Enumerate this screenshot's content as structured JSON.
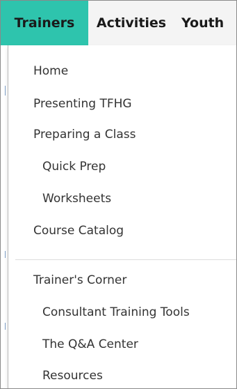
{
  "nav": {
    "tabs": [
      {
        "label": "Trainers",
        "active": true
      },
      {
        "label": "Activities",
        "active": false
      },
      {
        "label": "Youth",
        "active": false
      }
    ]
  },
  "dropdown": {
    "section_1": [
      {
        "label": "Home"
      },
      {
        "label": "Presenting TFHG"
      },
      {
        "label": "Preparing a Class"
      },
      {
        "label": "Quick Prep"
      },
      {
        "label": "Worksheets"
      },
      {
        "label": "Course Catalog"
      }
    ],
    "section_2": [
      {
        "label": "Trainer's Corner"
      },
      {
        "label": "Consultant Training Tools"
      },
      {
        "label": "The Q&A Center"
      },
      {
        "label": "Resources"
      }
    ]
  },
  "colors": {
    "active_tab": "#2ec4ad",
    "nav_background": "#f4f4f4",
    "text": "#333333"
  }
}
